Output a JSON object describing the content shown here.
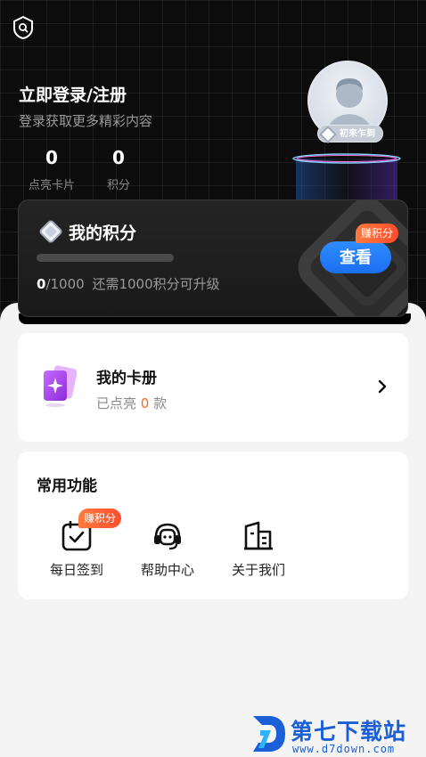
{
  "header": {
    "login_title": "立即登录/注册",
    "login_subtitle": "登录获取更多精彩内容",
    "stats": [
      {
        "value": "0",
        "label": "点亮卡片"
      },
      {
        "value": "0",
        "label": "积分"
      }
    ],
    "level_badge": "初来乍到"
  },
  "points_card": {
    "title": "我的积分",
    "current": "0",
    "total": "/1000",
    "hint": "还需1000积分可升级",
    "progress": 0,
    "view_label": "查看",
    "earn_tag": "赚积分"
  },
  "album": {
    "title": "我的卡册",
    "sub_prefix": "已点亮",
    "count": "0",
    "sub_suffix": "款"
  },
  "functions": {
    "title": "常用功能",
    "items": [
      {
        "label": "每日签到",
        "icon": "calendar-check-icon"
      },
      {
        "label": "帮助中心",
        "icon": "headset-icon"
      },
      {
        "label": "关于我们",
        "icon": "building-icon"
      }
    ],
    "earn_tag": "赚积分"
  },
  "watermark": {
    "name": "第七下载站",
    "url": "www.d7down.com"
  },
  "colors": {
    "accent_blue": "#1b6ff0",
    "earn_orange": "#ff4d2e",
    "count_orange": "#f36b1f",
    "header_bg": "#0c0c0c"
  }
}
